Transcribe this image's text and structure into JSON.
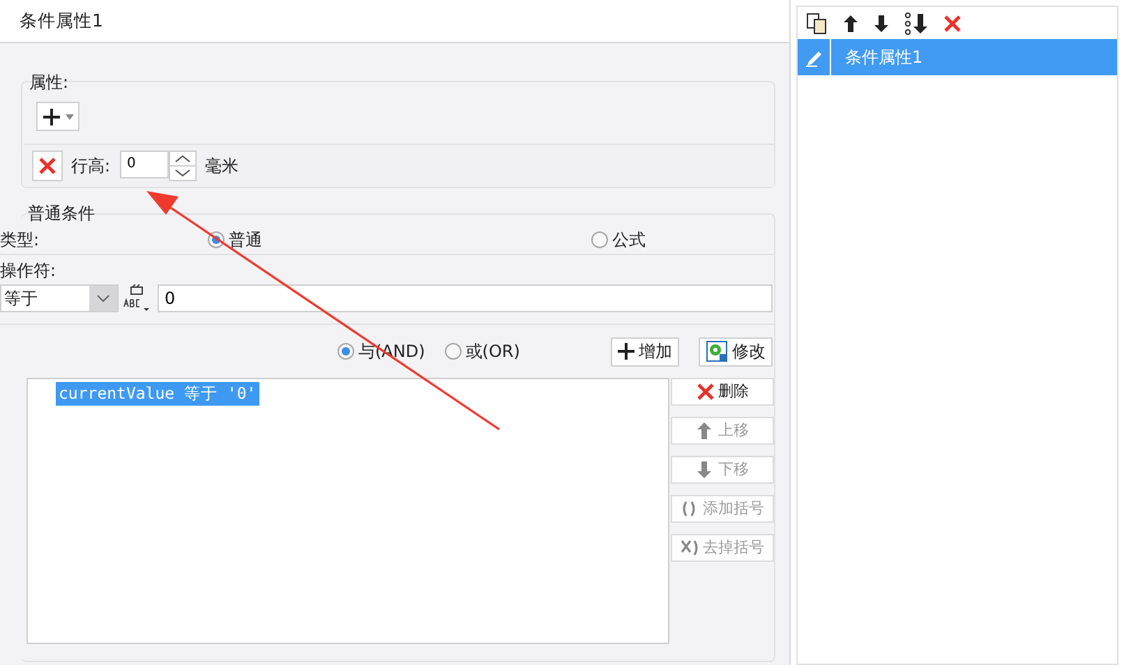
{
  "window": {
    "title": "条件属性1"
  },
  "properties": {
    "label": "属性:",
    "rows": [
      {
        "label": "行高:",
        "value": "0",
        "unit": "毫米"
      }
    ]
  },
  "condition": {
    "label": "普通条件",
    "type_label": "类型:",
    "types": [
      {
        "label": "普通",
        "selected": true
      },
      {
        "label": "公式",
        "selected": false
      }
    ],
    "operator_label": "操作符:",
    "operator": "等于",
    "operand": "0",
    "joins": [
      {
        "label": "与(AND)",
        "selected": true
      },
      {
        "label": "或(OR)",
        "selected": false
      }
    ],
    "actions": [
      {
        "label": "增加",
        "kind": "add"
      },
      {
        "label": "修改",
        "kind": "edit"
      }
    ],
    "items": [
      {
        "text": "currentValue 等于 '0'",
        "selected": true
      }
    ],
    "item_buttons": [
      {
        "label": "删除",
        "kind": "delete",
        "disabled": false
      },
      {
        "label": "上移",
        "kind": "up",
        "disabled": true
      },
      {
        "label": "下移",
        "kind": "down",
        "disabled": true
      },
      {
        "label": "添加括号",
        "kind": "paren-add",
        "disabled": true
      },
      {
        "label": "去掉括号",
        "kind": "paren-remove",
        "disabled": true
      }
    ]
  },
  "side": {
    "items": [
      {
        "label": "条件属性1",
        "selected": true
      }
    ]
  }
}
